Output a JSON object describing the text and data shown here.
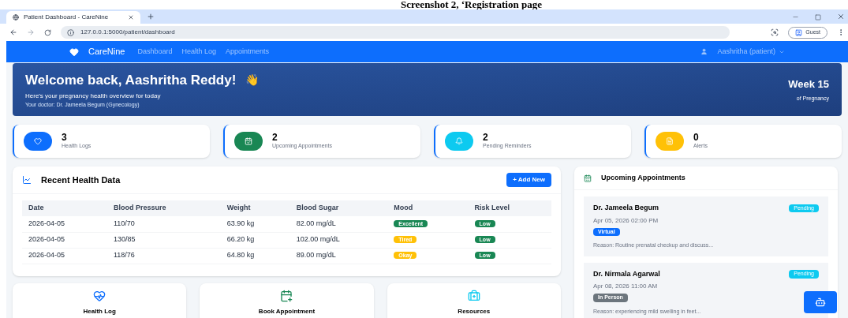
{
  "caption": "Screenshot 2, ‘Registration page",
  "browser": {
    "tab_title": "Patient Dashboard - CareNine",
    "url": "127.0.0.1:5000/patient/dashboard",
    "profile": "Guest"
  },
  "navbar": {
    "brand": "CareNine",
    "links": [
      {
        "label": "Dashboard"
      },
      {
        "label": "Health Log"
      },
      {
        "label": "Appointments"
      }
    ],
    "user": "Aashritha (patient)"
  },
  "hero": {
    "title": "Welcome back, Aashritha Reddy!",
    "emoji": "👋",
    "subtitle": "Here's your pregnancy health overview for today",
    "doctor": "Your doctor: Dr. Jameela Begum (Gynecology)",
    "week": "Week 15",
    "week_caption": "of Pregnancy"
  },
  "stats": [
    {
      "value": "3",
      "label": "Health Logs",
      "kind": "heart",
      "color": "#0d6efd"
    },
    {
      "value": "2",
      "label": "Upcoming Appointments",
      "kind": "calendar",
      "color": "#198754"
    },
    {
      "value": "2",
      "label": "Pending Reminders",
      "kind": "bell",
      "color": "#0dcaf0"
    },
    {
      "value": "0",
      "label": "Alerts",
      "kind": "file",
      "color": "#ffc107"
    }
  ],
  "health_data": {
    "title": "Recent Health Data",
    "add_button": "+ Add New",
    "columns": [
      "Date",
      "Blood Pressure",
      "Weight",
      "Blood Sugar",
      "Mood",
      "Risk Level"
    ],
    "rows": [
      {
        "date": "2026-04-05",
        "bp": "110/70",
        "weight": "63.90 kg",
        "sugar": "82.00 mg/dL",
        "mood": {
          "label": "Excellent",
          "color": "#198754"
        },
        "risk": {
          "label": "Low",
          "color": "#198754"
        }
      },
      {
        "date": "2026-04-05",
        "bp": "130/85",
        "weight": "66.20 kg",
        "sugar": "102.00 mg/dL",
        "mood": {
          "label": "Tired",
          "color": "#ffc107"
        },
        "risk": {
          "label": "Low",
          "color": "#198754"
        }
      },
      {
        "date": "2026-04-05",
        "bp": "118/76",
        "weight": "64.80 kg",
        "sugar": "89.00 mg/dL",
        "mood": {
          "label": "Okay",
          "color": "#ffc107"
        },
        "risk": {
          "label": "Low",
          "color": "#198754"
        }
      }
    ]
  },
  "appointments": {
    "title": "Upcoming Appointments",
    "items": [
      {
        "doctor": "Dr. Jameela Begum",
        "when": "Apr 05, 2026 02:00 PM",
        "status": "Pending",
        "mode": {
          "label": "Virtual",
          "color": "#0d6efd"
        },
        "reason": "Reason: Routine prenatal checkup and discuss..."
      },
      {
        "doctor": "Dr. Nirmala Agarwal",
        "when": "Apr 08, 2026 11:00 AM",
        "status": "Pending",
        "mode": {
          "label": "In Person",
          "color": "#6c757d"
        },
        "reason": "Reason: experiencing mild swelling in feet..."
      }
    ]
  },
  "quick_actions": [
    {
      "label": "Health Log",
      "kind": "heart",
      "color": "#0d6efd"
    },
    {
      "label": "Book Appointment",
      "kind": "calendar-plus",
      "color": "#198754"
    },
    {
      "label": "Resources",
      "kind": "medical",
      "color": "#0dcaf0"
    }
  ]
}
